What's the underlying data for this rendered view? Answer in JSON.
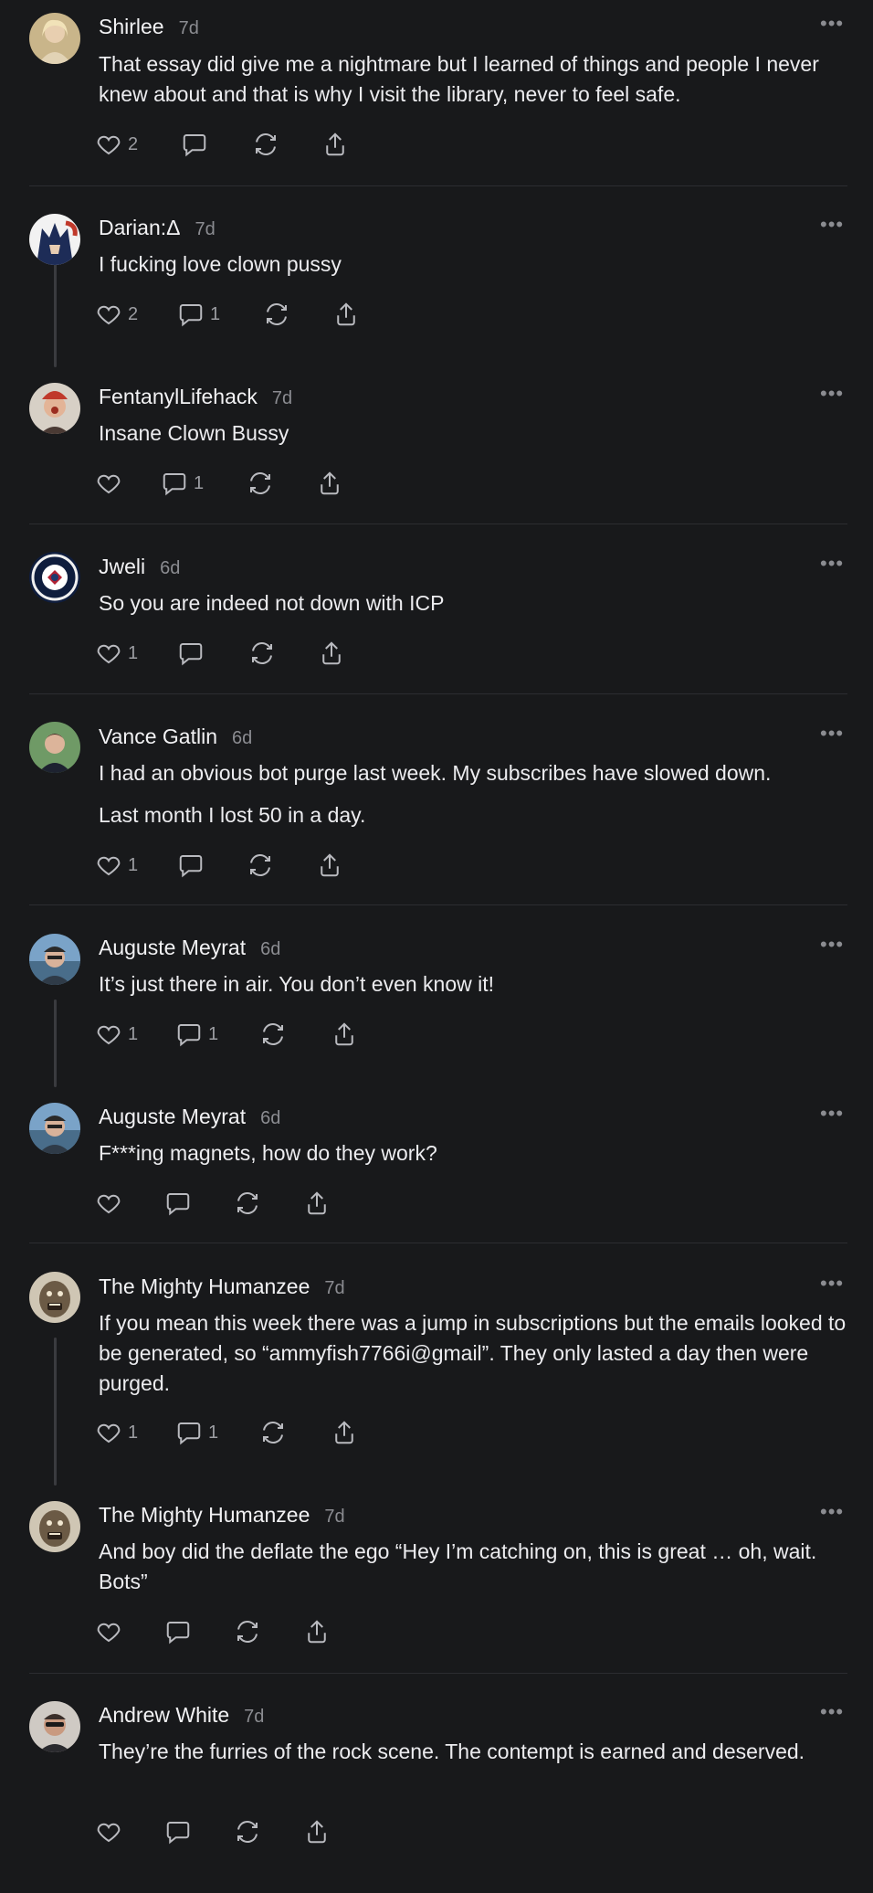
{
  "posts": [
    {
      "author": "Shirlee",
      "time": "7d",
      "body": [
        "That essay did give me a nightmare but I learned of things and people I never knew about and that is why I visit the library, never to feel safe."
      ],
      "likes": "2",
      "replies": "",
      "avatar": "#d9c39a"
    },
    {
      "author": "Darian:Δ",
      "time": "7d",
      "body": [
        "I fucking love clown pussy"
      ],
      "likes": "2",
      "replies": "1",
      "avatar": "#2b3f7a"
    },
    {
      "author": "FentanylLifehack",
      "time": "7d",
      "body": [
        "Insane Clown Bussy"
      ],
      "likes": "",
      "replies": "1",
      "avatar": "#9a4a3c"
    },
    {
      "author": "Jweli",
      "time": "6d",
      "body": [
        "So you are indeed not down with ICP"
      ],
      "likes": "1",
      "replies": "",
      "avatar": "#1f3a6e"
    },
    {
      "author": "Vance Gatlin",
      "time": "6d",
      "body": [
        "I had an obvious bot purge last week. My subscribes have slowed down.",
        "Last month I lost 50 in a day."
      ],
      "likes": "1",
      "replies": "",
      "avatar": "#4f7a4a"
    },
    {
      "author": "Auguste Meyrat",
      "time": "6d",
      "body": [
        "It’s just there in air. You don’t even know it!"
      ],
      "likes": "1",
      "replies": "1",
      "avatar": "#6a8fb3"
    },
    {
      "author": "Auguste Meyrat",
      "time": "6d",
      "body": [
        "F***ing magnets, how do they work?"
      ],
      "likes": "",
      "replies": "",
      "avatar": "#6a8fb3"
    },
    {
      "author": "The Mighty Humanzee",
      "time": "7d",
      "body": [
        "If you mean this week there was a jump in subscriptions but the emails looked to be generated, so “ammyfish7766i@gmail”. They only lasted a day then were purged."
      ],
      "likes": "1",
      "replies": "1",
      "avatar": "#8a7c64"
    },
    {
      "author": "The Mighty Humanzee",
      "time": "7d",
      "body": [
        "And boy did the deflate the ego “Hey I’m catching on, this is great … oh, wait. Bots”"
      ],
      "likes": "",
      "replies": "",
      "avatar": "#8a7c64"
    },
    {
      "author": "Andrew White",
      "time": "7d",
      "body": [
        "They’re the furries of the rock scene. The contempt is earned and deserved."
      ],
      "likes": "",
      "replies": "",
      "avatar": "#7a6a60"
    }
  ]
}
